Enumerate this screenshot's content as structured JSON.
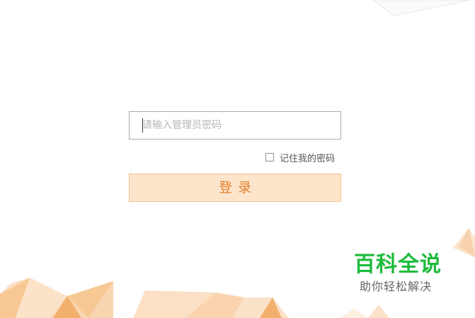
{
  "login": {
    "password_placeholder": "请输入管理员密码",
    "password_value": "",
    "remember_label": "记住我的密码",
    "remember_checked": false,
    "submit_label": "登录"
  },
  "watermark": {
    "title": "百科全说",
    "subtitle": "助你轻松解决"
  },
  "colors": {
    "button_bg": "#fde5cc",
    "button_border": "#f2c38e",
    "button_text": "#e0802a",
    "watermark_green": "#1dbb3b",
    "decor_orange": "#f5b878"
  }
}
